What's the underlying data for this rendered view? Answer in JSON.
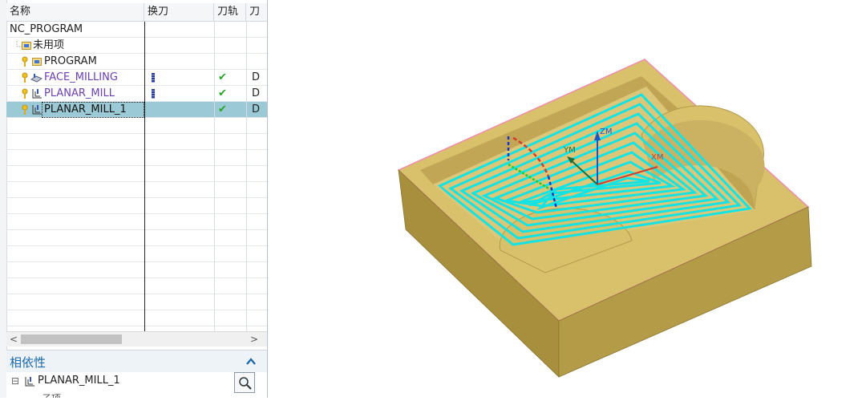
{
  "navigator": {
    "columns": {
      "name": "名称",
      "tool_change": "换刀",
      "toolpath": "刀轨",
      "partial": "刀"
    },
    "rows": [
      {
        "label": "NC_PROGRAM"
      },
      {
        "label": "未用项"
      },
      {
        "label": "PROGRAM"
      },
      {
        "label": "FACE_MILLING",
        "toolpath_status": "✔",
        "cut_col": "D"
      },
      {
        "label": "PLANAR_MILL",
        "toolpath_status": "✔",
        "cut_col": "D"
      },
      {
        "label": "PLANAR_MILL_1",
        "toolpath_status": "✔",
        "cut_col": "D",
        "selected": true
      }
    ],
    "scroll_left": "<",
    "scroll_right": ">",
    "dependency": {
      "title": "相依性",
      "collapse": "^",
      "item": "PLANAR_MILL_1",
      "child": "子项"
    }
  },
  "viewport": {
    "axes": {
      "zm": "ZM",
      "ym": "YM",
      "xm": "XM"
    },
    "colors": {
      "stock": "#d9c06b",
      "stock_side": "#a78f3e",
      "toolpath": "#14e3e3",
      "edge": "#f08ab0",
      "zm": "#1a55c9",
      "xm": "#d63a2a"
    }
  }
}
